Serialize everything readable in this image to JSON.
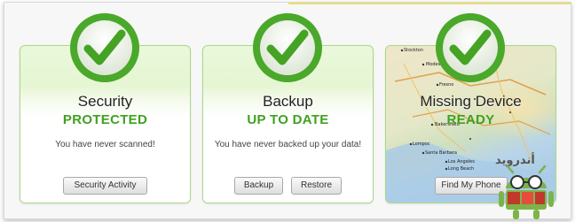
{
  "cards": [
    {
      "title": "Security",
      "status": "PROTECTED",
      "message": "You have never scanned!",
      "buttons": [
        "Security Activity"
      ]
    },
    {
      "title": "Backup",
      "status": "UP TO DATE",
      "message": "You have never backed up your data!",
      "buttons": [
        "Backup",
        "Restore"
      ]
    },
    {
      "title": "Missing Device",
      "status": "READY",
      "buttons": [
        "Find My Phone"
      ]
    }
  ],
  "map_labels": [
    "Stockton",
    "Modesto",
    "Fresno",
    "Bakersfield",
    "Santa Barbara",
    "Lompoc",
    "Los Angeles",
    "Long Beach"
  ],
  "watermark_text": "أندرويد",
  "colors": {
    "status_green": "#3fa11f",
    "card_border": "#a9d98a",
    "check_ring": "#4aa82a"
  },
  "icons": [
    "check-icon",
    "check-icon",
    "check-icon"
  ]
}
